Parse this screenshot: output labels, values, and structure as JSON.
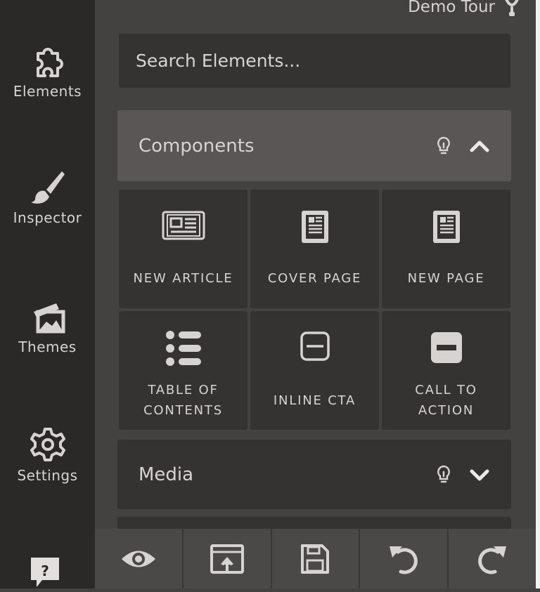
{
  "header": {
    "demo_tour_label": "Demo Tour"
  },
  "sidebar": {
    "items": [
      {
        "label": "Elements",
        "icon": "puzzle-icon"
      },
      {
        "label": "Inspector",
        "icon": "brush-icon"
      },
      {
        "label": "Themes",
        "icon": "images-icon"
      },
      {
        "label": "Settings",
        "icon": "gear-icon"
      }
    ],
    "help_icon": "help-icon",
    "help_text": "?"
  },
  "search": {
    "placeholder": "Search Elements..."
  },
  "sections": {
    "components": {
      "title": "Components",
      "expanded": true
    },
    "media": {
      "title": "Media",
      "expanded": false
    }
  },
  "components": [
    {
      "label": "NEW ARTICLE",
      "icon": "newspaper-icon"
    },
    {
      "label": "COVER PAGE",
      "icon": "document-icon"
    },
    {
      "label": "NEW PAGE",
      "icon": "document-icon"
    },
    {
      "label": "TABLE OF\nCONTENTS",
      "icon": "list-icon"
    },
    {
      "label": "INLINE CTA",
      "icon": "minus-square-outline-icon"
    },
    {
      "label": "CALL TO\nACTION",
      "icon": "minus-square-filled-icon"
    }
  ],
  "toolbar": {
    "buttons": [
      {
        "name": "preview-button",
        "icon": "eye-icon"
      },
      {
        "name": "publish-button",
        "icon": "upload-window-icon"
      },
      {
        "name": "save-button",
        "icon": "floppy-disk-icon"
      },
      {
        "name": "undo-button",
        "icon": "undo-icon"
      },
      {
        "name": "redo-button",
        "icon": "redo-icon"
      }
    ]
  },
  "colors": {
    "sidebar_bg": "#2a2928",
    "panel_bg": "#444241",
    "tile_bg": "#353332",
    "active_header_bg": "#595655",
    "text": "#d6d3d0"
  }
}
